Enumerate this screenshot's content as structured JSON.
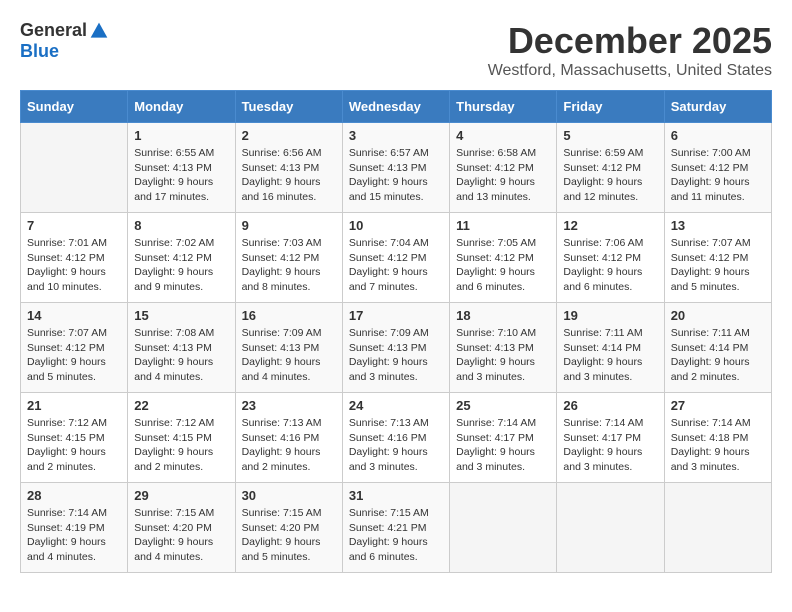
{
  "logo": {
    "general": "General",
    "blue": "Blue"
  },
  "title": "December 2025",
  "subtitle": "Westford, Massachusetts, United States",
  "days_of_week": [
    "Sunday",
    "Monday",
    "Tuesday",
    "Wednesday",
    "Thursday",
    "Friday",
    "Saturday"
  ],
  "weeks": [
    [
      {
        "day": "",
        "info": ""
      },
      {
        "day": "1",
        "info": "Sunrise: 6:55 AM\nSunset: 4:13 PM\nDaylight: 9 hours\nand 17 minutes."
      },
      {
        "day": "2",
        "info": "Sunrise: 6:56 AM\nSunset: 4:13 PM\nDaylight: 9 hours\nand 16 minutes."
      },
      {
        "day": "3",
        "info": "Sunrise: 6:57 AM\nSunset: 4:13 PM\nDaylight: 9 hours\nand 15 minutes."
      },
      {
        "day": "4",
        "info": "Sunrise: 6:58 AM\nSunset: 4:12 PM\nDaylight: 9 hours\nand 13 minutes."
      },
      {
        "day": "5",
        "info": "Sunrise: 6:59 AM\nSunset: 4:12 PM\nDaylight: 9 hours\nand 12 minutes."
      },
      {
        "day": "6",
        "info": "Sunrise: 7:00 AM\nSunset: 4:12 PM\nDaylight: 9 hours\nand 11 minutes."
      }
    ],
    [
      {
        "day": "7",
        "info": "Sunrise: 7:01 AM\nSunset: 4:12 PM\nDaylight: 9 hours\nand 10 minutes."
      },
      {
        "day": "8",
        "info": "Sunrise: 7:02 AM\nSunset: 4:12 PM\nDaylight: 9 hours\nand 9 minutes."
      },
      {
        "day": "9",
        "info": "Sunrise: 7:03 AM\nSunset: 4:12 PM\nDaylight: 9 hours\nand 8 minutes."
      },
      {
        "day": "10",
        "info": "Sunrise: 7:04 AM\nSunset: 4:12 PM\nDaylight: 9 hours\nand 7 minutes."
      },
      {
        "day": "11",
        "info": "Sunrise: 7:05 AM\nSunset: 4:12 PM\nDaylight: 9 hours\nand 6 minutes."
      },
      {
        "day": "12",
        "info": "Sunrise: 7:06 AM\nSunset: 4:12 PM\nDaylight: 9 hours\nand 6 minutes."
      },
      {
        "day": "13",
        "info": "Sunrise: 7:07 AM\nSunset: 4:12 PM\nDaylight: 9 hours\nand 5 minutes."
      }
    ],
    [
      {
        "day": "14",
        "info": "Sunrise: 7:07 AM\nSunset: 4:12 PM\nDaylight: 9 hours\nand 5 minutes."
      },
      {
        "day": "15",
        "info": "Sunrise: 7:08 AM\nSunset: 4:13 PM\nDaylight: 9 hours\nand 4 minutes."
      },
      {
        "day": "16",
        "info": "Sunrise: 7:09 AM\nSunset: 4:13 PM\nDaylight: 9 hours\nand 4 minutes."
      },
      {
        "day": "17",
        "info": "Sunrise: 7:09 AM\nSunset: 4:13 PM\nDaylight: 9 hours\nand 3 minutes."
      },
      {
        "day": "18",
        "info": "Sunrise: 7:10 AM\nSunset: 4:13 PM\nDaylight: 9 hours\nand 3 minutes."
      },
      {
        "day": "19",
        "info": "Sunrise: 7:11 AM\nSunset: 4:14 PM\nDaylight: 9 hours\nand 3 minutes."
      },
      {
        "day": "20",
        "info": "Sunrise: 7:11 AM\nSunset: 4:14 PM\nDaylight: 9 hours\nand 2 minutes."
      }
    ],
    [
      {
        "day": "21",
        "info": "Sunrise: 7:12 AM\nSunset: 4:15 PM\nDaylight: 9 hours\nand 2 minutes."
      },
      {
        "day": "22",
        "info": "Sunrise: 7:12 AM\nSunset: 4:15 PM\nDaylight: 9 hours\nand 2 minutes."
      },
      {
        "day": "23",
        "info": "Sunrise: 7:13 AM\nSunset: 4:16 PM\nDaylight: 9 hours\nand 2 minutes."
      },
      {
        "day": "24",
        "info": "Sunrise: 7:13 AM\nSunset: 4:16 PM\nDaylight: 9 hours\nand 3 minutes."
      },
      {
        "day": "25",
        "info": "Sunrise: 7:14 AM\nSunset: 4:17 PM\nDaylight: 9 hours\nand 3 minutes."
      },
      {
        "day": "26",
        "info": "Sunrise: 7:14 AM\nSunset: 4:17 PM\nDaylight: 9 hours\nand 3 minutes."
      },
      {
        "day": "27",
        "info": "Sunrise: 7:14 AM\nSunset: 4:18 PM\nDaylight: 9 hours\nand 3 minutes."
      }
    ],
    [
      {
        "day": "28",
        "info": "Sunrise: 7:14 AM\nSunset: 4:19 PM\nDaylight: 9 hours\nand 4 minutes."
      },
      {
        "day": "29",
        "info": "Sunrise: 7:15 AM\nSunset: 4:20 PM\nDaylight: 9 hours\nand 4 minutes."
      },
      {
        "day": "30",
        "info": "Sunrise: 7:15 AM\nSunset: 4:20 PM\nDaylight: 9 hours\nand 5 minutes."
      },
      {
        "day": "31",
        "info": "Sunrise: 7:15 AM\nSunset: 4:21 PM\nDaylight: 9 hours\nand 6 minutes."
      },
      {
        "day": "",
        "info": ""
      },
      {
        "day": "",
        "info": ""
      },
      {
        "day": "",
        "info": ""
      }
    ]
  ]
}
